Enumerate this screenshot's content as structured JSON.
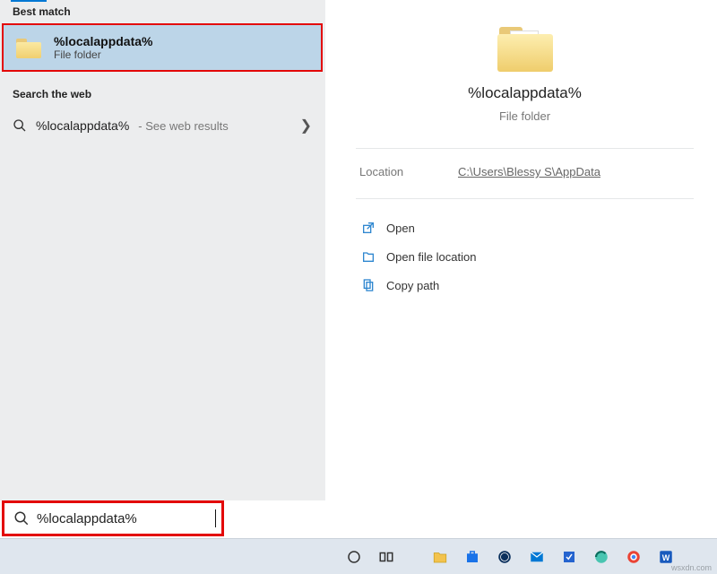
{
  "left": {
    "best_match_header": "Best match",
    "best_match": {
      "title": "%localappdata%",
      "subtitle": "File folder"
    },
    "web_header": "Search the web",
    "web": {
      "query": "%localappdata%",
      "hint": "- See web results"
    }
  },
  "right": {
    "title": "%localappdata%",
    "subtitle": "File folder",
    "location_key": "Location",
    "location_val": "C:\\Users\\Blessy S\\AppData",
    "actions": {
      "open": "Open",
      "open_loc": "Open file location",
      "copy_path": "Copy path"
    }
  },
  "search": {
    "value": "%localappdata%"
  },
  "watermark": "wsxdn.com"
}
